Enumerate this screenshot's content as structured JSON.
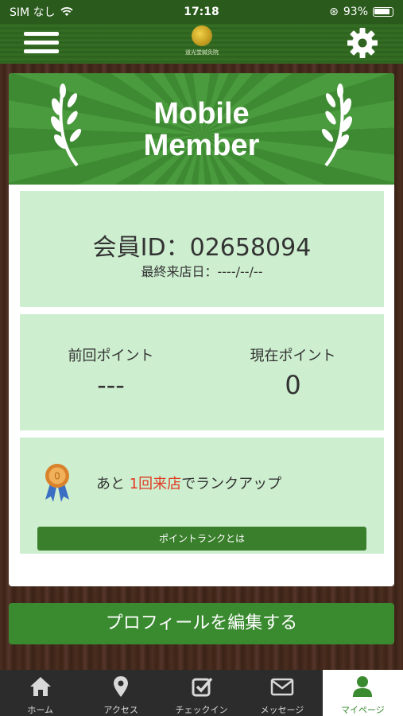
{
  "status_bar": {
    "carrier": "SIM なし",
    "time": "17:18",
    "battery": "93%"
  },
  "header": {
    "logo_text": "道光堂鍼灸院"
  },
  "banner": {
    "line1": "Mobile",
    "line2": "Member"
  },
  "member": {
    "id_label": "会員ID：02658094",
    "last_visit": "最終来店日：----/--/--"
  },
  "points": {
    "previous_label": "前回ポイント",
    "previous_value": "---",
    "current_label": "現在ポイント",
    "current_value": "0"
  },
  "rank": {
    "prefix": "あと ",
    "highlight": "1回来店",
    "suffix": "でランクアップ",
    "button_label": "ポイントランクとは"
  },
  "edit_profile_label": "プロフィールを編集する",
  "tabs": [
    {
      "label": "ホーム",
      "icon": "home-icon"
    },
    {
      "label": "アクセス",
      "icon": "location-pin-icon"
    },
    {
      "label": "チェックイン",
      "icon": "checkbox-icon"
    },
    {
      "label": "メッセージ",
      "icon": "envelope-icon"
    },
    {
      "label": "マイページ",
      "icon": "user-icon",
      "active": true
    }
  ],
  "colors": {
    "accent_green": "#3a8a30",
    "panel_green": "#cdeecf",
    "highlight_red": "#e03b24"
  }
}
